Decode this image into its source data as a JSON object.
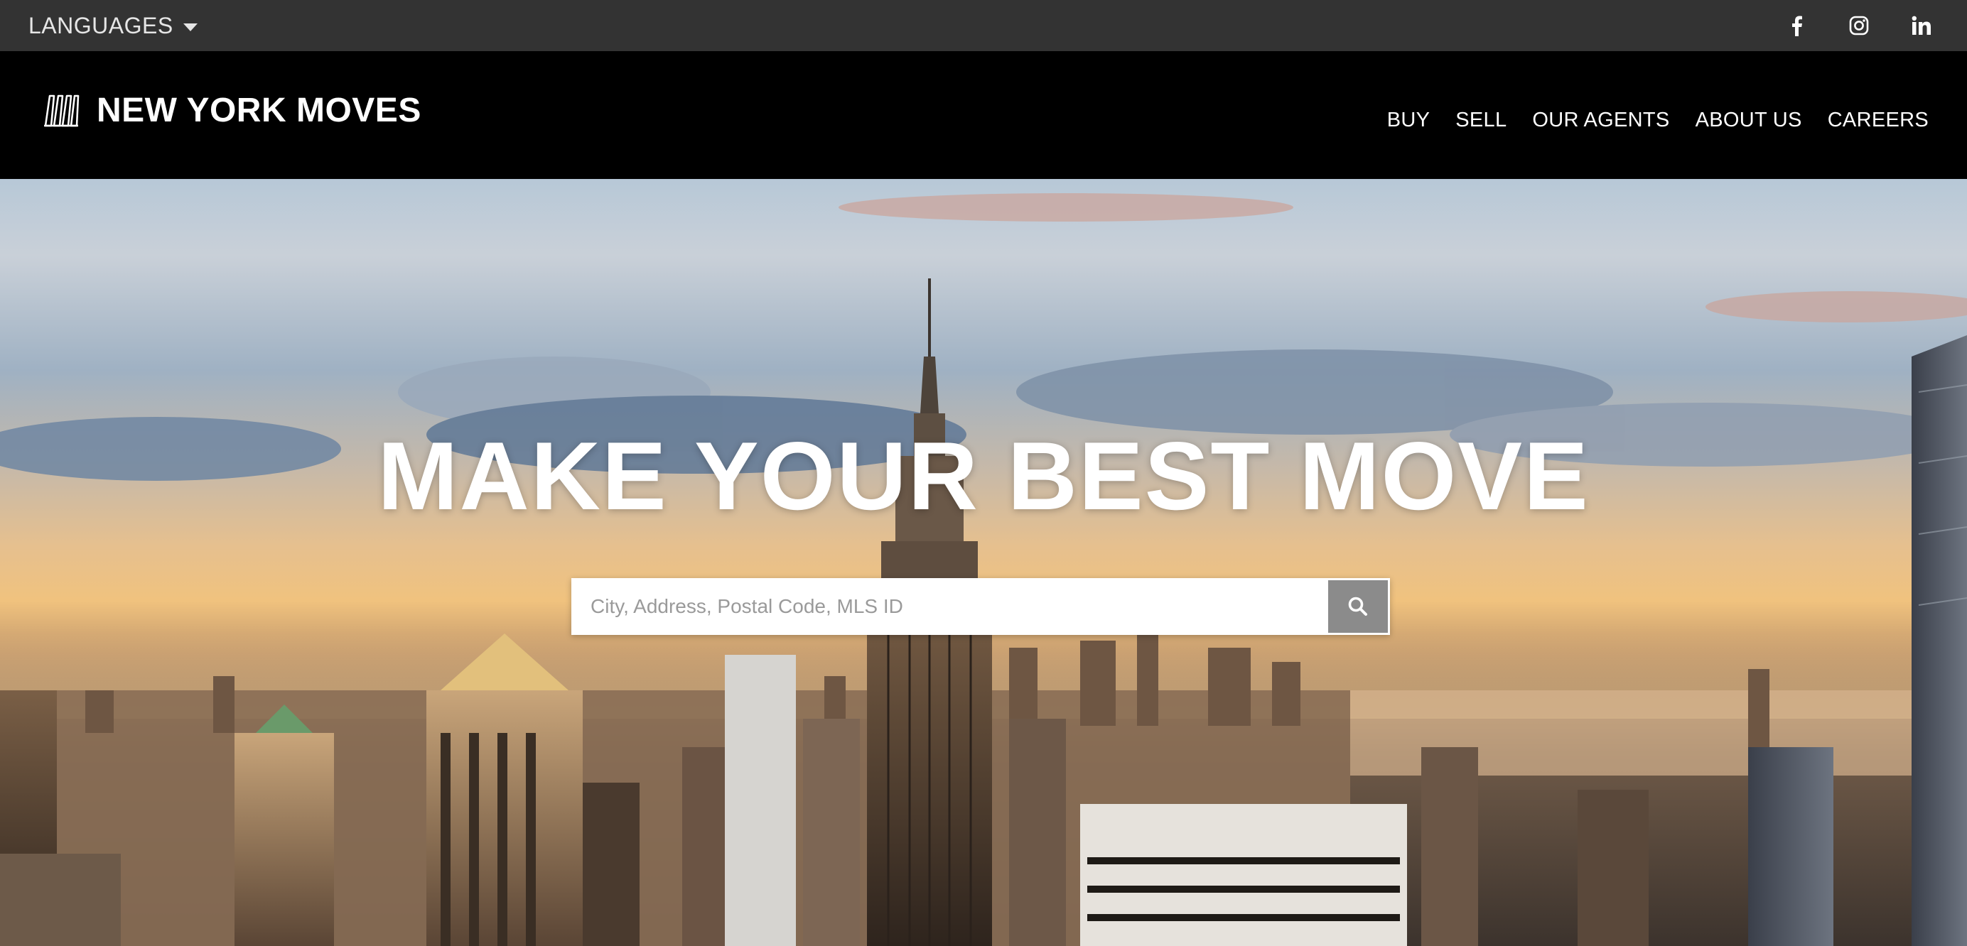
{
  "topbar": {
    "languages_label": "LANGUAGES",
    "languages_icon": "caret-down-icon",
    "social": [
      {
        "name": "facebook",
        "icon": "facebook-icon"
      },
      {
        "name": "instagram",
        "icon": "instagram-icon"
      },
      {
        "name": "linkedin",
        "icon": "linkedin-icon"
      }
    ]
  },
  "header": {
    "brand_name": "NEW YORK MOVES",
    "brand_icon": "building-logo-icon",
    "nav": [
      "BUY",
      "SELL",
      "OUR AGENTS",
      "ABOUT US",
      "CAREERS"
    ]
  },
  "hero": {
    "title": "MAKE YOUR BEST MOVE",
    "search": {
      "placeholder": "City, Address, Postal Code, MLS ID",
      "value": "",
      "button_icon": "search-icon"
    }
  },
  "colors": {
    "topbar_bg": "#333333",
    "header_bg": "#000000",
    "search_button_bg": "#8b8b8b",
    "text": "#ffffff"
  }
}
